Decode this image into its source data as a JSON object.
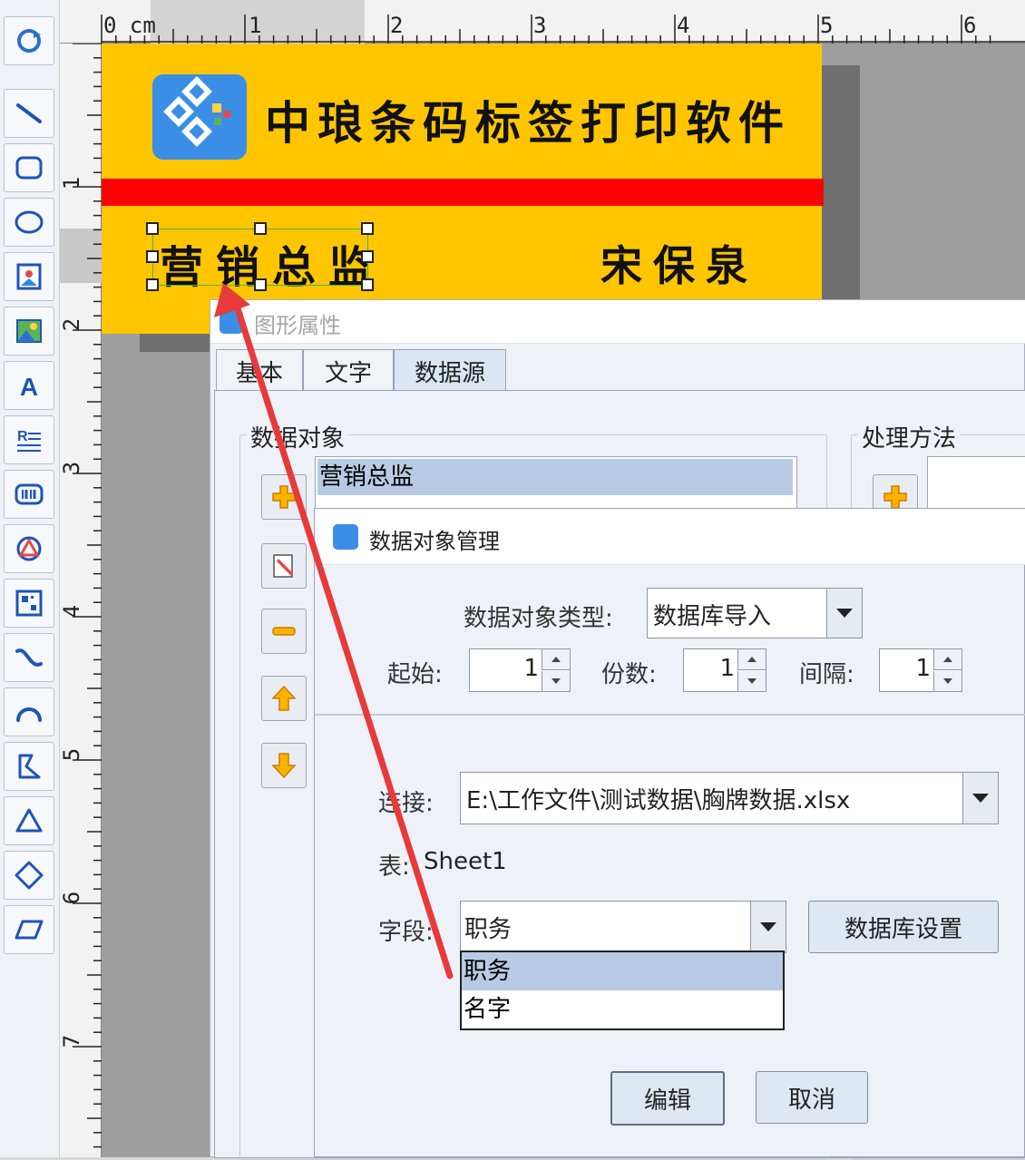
{
  "palette": {
    "tools": [
      {
        "icon": "refresh-icon"
      },
      {
        "icon": "line-icon"
      },
      {
        "icon": "rounded-rect-icon"
      },
      {
        "icon": "ellipse-icon"
      },
      {
        "icon": "image-icon"
      },
      {
        "icon": "picture-icon"
      },
      {
        "icon": "text-icon"
      },
      {
        "icon": "rich-text-icon"
      },
      {
        "icon": "barcode-icon"
      },
      {
        "icon": "shape-icon"
      },
      {
        "icon": "qrcode-icon"
      },
      {
        "icon": "curve-icon"
      },
      {
        "icon": "arc-icon"
      },
      {
        "icon": "polygon-icon"
      },
      {
        "icon": "triangle-icon"
      },
      {
        "icon": "diamond-icon"
      },
      {
        "icon": "parallelogram-icon"
      }
    ]
  },
  "ruler": {
    "unit": "0 cm",
    "h_numbers": [
      "1",
      "2",
      "3",
      "4",
      "5",
      "6"
    ],
    "v_numbers": [
      "1",
      "2",
      "3",
      "4",
      "5",
      "6",
      "7"
    ]
  },
  "label": {
    "title": "中琅条码标签打印软件",
    "role": "营销总监",
    "name": "宋保泉",
    "colors": {
      "background": "#ffc600",
      "bar": "#ff0000"
    }
  },
  "dialog1": {
    "title": "图形属性",
    "tabs": [
      "基本",
      "文字",
      "数据源"
    ],
    "active_tab": "数据源",
    "data_object_group": "数据对象",
    "processing_group": "处理方法",
    "data_object_item": "营销总监"
  },
  "dialog2": {
    "title": "数据对象管理",
    "type_label": "数据对象类型:",
    "type_value": "数据库导入",
    "start_label": "起始:",
    "start_value": "1",
    "copies_label": "份数:",
    "copies_value": "1",
    "interval_label": "间隔:",
    "interval_value": "1",
    "connection_label": "连接:",
    "connection_value": "E:\\工作文件\\测试数据\\胸牌数据.xlsx",
    "table_label": "表:",
    "table_value": "Sheet1",
    "field_label": "字段:",
    "field_value": "职务",
    "db_settings_button": "数据库设置",
    "field_options": [
      "职务",
      "名字"
    ],
    "edit_button": "编辑",
    "cancel_button": "取消"
  }
}
